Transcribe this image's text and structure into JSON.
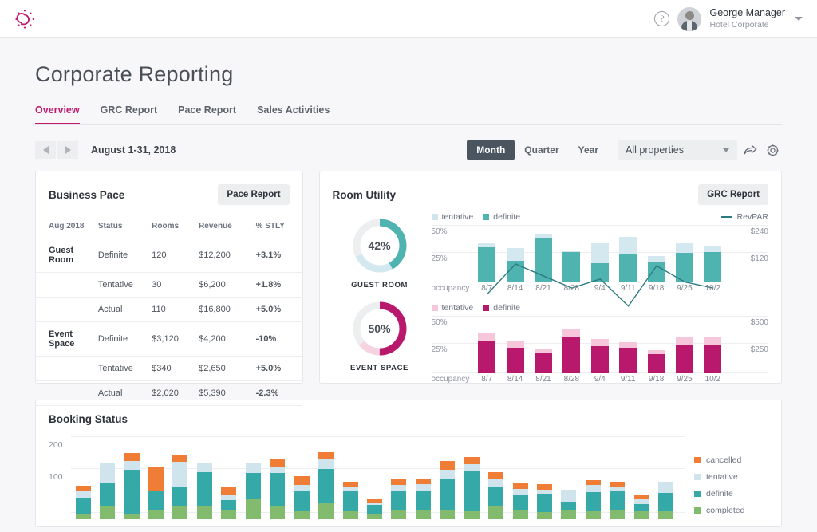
{
  "topbar": {
    "logo_icon": "sun-bulb-logo-icon",
    "help_icon": "help-circle-icon",
    "help_label": "?",
    "avatar_icon": "user-avatar",
    "user_name": "George Manager",
    "user_org": "Hotel Corporate",
    "caret_icon": "chevron-down-icon"
  },
  "page": {
    "title": "Corporate Reporting",
    "tabs": [
      {
        "label": "Overview",
        "active": true
      },
      {
        "label": "GRC Report",
        "active": false
      },
      {
        "label": "Pace Report",
        "active": false
      },
      {
        "label": "Sales Activities",
        "active": false
      }
    ]
  },
  "toolbar": {
    "prev_icon": "chevron-left-icon",
    "next_icon": "chevron-right-icon",
    "date_range": "August 1-31, 2018",
    "periods": [
      {
        "label": "Month",
        "active": true
      },
      {
        "label": "Quarter",
        "active": false
      },
      {
        "label": "Year",
        "active": false
      }
    ],
    "property_filter": "All properties",
    "share_icon": "share-arrow-icon",
    "settings_icon": "gear-icon"
  },
  "business_pace": {
    "title": "Business Pace",
    "action_label": "Pace Report",
    "columns": [
      "Aug 2018",
      "Status",
      "Rooms",
      "Revenue",
      "% STLY"
    ],
    "rows": [
      {
        "group": "Guest Room",
        "status": "Definite",
        "rooms": "120",
        "revenue": "$12,200",
        "stly": "+3.1%",
        "trend": "pos",
        "separator": false
      },
      {
        "group": "",
        "status": "Tentative",
        "rooms": "30",
        "revenue": "$6,200",
        "stly": "+1.8%",
        "trend": "pos",
        "separator": false
      },
      {
        "group": "",
        "status": "Actual",
        "rooms": "110",
        "revenue": "$16,800",
        "stly": "+5.0%",
        "trend": "pos",
        "separator": false
      },
      {
        "group": "Event Space",
        "status": "Definite",
        "rooms": "$3,120",
        "revenue": "$4,200",
        "stly": "-10%",
        "trend": "neg",
        "separator": true
      },
      {
        "group": "",
        "status": "Tentative",
        "rooms": "$340",
        "revenue": "$2,650",
        "stly": "+5.0%",
        "trend": "pos",
        "separator": false
      },
      {
        "group": "",
        "status": "Actual",
        "rooms": "$2,020",
        "revenue": "$5,390",
        "stly": "-2.3%",
        "trend": "neg",
        "separator": false
      }
    ]
  },
  "room_utility": {
    "title": "Room Utility",
    "action_label": "GRC Report",
    "donuts": [
      {
        "value": "42%",
        "label": "GUEST ROOM",
        "pct": 42,
        "secondary_pct": 26,
        "color": "#4fb3b0",
        "secondary_color": "#d4e9ef",
        "track": "#eceef0"
      },
      {
        "value": "50%",
        "label": "EVENT SPACE",
        "pct": 50,
        "secondary_pct": 14,
        "color": "#b8196c",
        "secondary_color": "#f6d3e1",
        "track": "#eceef0"
      }
    ]
  },
  "chart_data": [
    {
      "type": "bar",
      "name": "guest-room-occupancy",
      "stacked": true,
      "title": "",
      "xlabel": "occupancy",
      "ylabel": "",
      "categories": [
        "8/7",
        "8/14",
        "8/21",
        "8/28",
        "9/4",
        "9/11",
        "9/18",
        "9/25",
        "10/2"
      ],
      "yticks": [
        "25%",
        "50%"
      ],
      "ylim": [
        0,
        62
      ],
      "y2ticks": [
        "$120",
        "$240"
      ],
      "y2lim": [
        0,
        300
      ],
      "series": [
        {
          "name": "definite",
          "color": "#4fb3b0",
          "values": [
            38,
            24,
            48,
            33,
            21,
            31,
            22,
            32,
            33
          ]
        },
        {
          "name": "tentative",
          "color": "#d4e9ef",
          "values": [
            5,
            14,
            5,
            1,
            22,
            19,
            7,
            11,
            7
          ]
        }
      ],
      "line": {
        "name": "RevPAR",
        "color": "#2b7a82",
        "values": [
          185,
          235,
          215,
          195,
          210,
          165,
          232,
          205,
          195
        ]
      },
      "legend": [
        "tentative",
        "definite",
        "RevPAR"
      ],
      "legend_position": "top"
    },
    {
      "type": "bar",
      "name": "event-space-occupancy",
      "stacked": true,
      "title": "",
      "xlabel": "occupancy",
      "ylabel": "",
      "categories": [
        "8/7",
        "8/14",
        "8/21",
        "8/28",
        "9/4",
        "9/11",
        "9/18",
        "9/25",
        "10/2"
      ],
      "yticks": [
        "25%",
        "50%"
      ],
      "ylim": [
        0,
        62
      ],
      "y2ticks": [
        "$250",
        "$500"
      ],
      "y2lim": [
        0,
        620
      ],
      "series": [
        {
          "name": "definite",
          "color": "#b8196c",
          "values": [
            35,
            28,
            22,
            39,
            30,
            28,
            21,
            31,
            31
          ]
        },
        {
          "name": "tentative",
          "color": "#f6c6da",
          "values": [
            9,
            7,
            4,
            10,
            8,
            6,
            4,
            9,
            9
          ]
        }
      ],
      "legend": [
        "tentative",
        "definite"
      ],
      "legend_position": "top"
    },
    {
      "type": "bar",
      "name": "booking-status",
      "stacked": true,
      "title": "Booking Status",
      "xlabel": "",
      "ylabel": "",
      "categories": [
        "1",
        "2",
        "3",
        "4",
        "5",
        "6",
        "7",
        "8",
        "9",
        "10",
        "11",
        "12",
        "13",
        "14",
        "15",
        "16",
        "17",
        "18",
        "19",
        "20",
        "21",
        "22",
        "23",
        "24",
        "25"
      ],
      "yticks": [
        "100",
        "200"
      ],
      "ylim": [
        0,
        230
      ],
      "series": [
        {
          "name": "completed",
          "color": "#83bb6e",
          "values": [
            18,
            40,
            16,
            28,
            38,
            40,
            26,
            62,
            40,
            25,
            48,
            24,
            14,
            28,
            28,
            30,
            25,
            38,
            28,
            22,
            30,
            25,
            26,
            24,
            24
          ]
        },
        {
          "name": "definite",
          "color": "#35a8a8",
          "values": [
            48,
            68,
            134,
            60,
            58,
            104,
            32,
            78,
            100,
            60,
            105,
            60,
            30,
            58,
            58,
            90,
            120,
            62,
            48,
            55,
            24,
            58,
            60,
            22,
            56
          ]
        },
        {
          "name": "tentative",
          "color": "#cfe4ed",
          "values": [
            18,
            62,
            26,
            0,
            78,
            28,
            18,
            30,
            20,
            18,
            30,
            12,
            4,
            18,
            20,
            30,
            22,
            22,
            16,
            12,
            36,
            20,
            14,
            14,
            34
          ]
        },
        {
          "name": "cancelled",
          "color": "#ef7d35",
          "values": [
            18,
            0,
            24,
            72,
            22,
            0,
            20,
            0,
            22,
            28,
            20,
            18,
            14,
            18,
            18,
            26,
            22,
            20,
            18,
            18,
            0,
            16,
            14,
            14,
            0
          ]
        }
      ],
      "legend": [
        "cancelled",
        "tentative",
        "definite",
        "completed"
      ],
      "legend_position": "right"
    }
  ],
  "booking_status": {
    "title": "Booking Status",
    "legend": [
      {
        "label": "cancelled",
        "color": "#ef7d35"
      },
      {
        "label": "tentative",
        "color": "#cfe4ed"
      },
      {
        "label": "definite",
        "color": "#35a8a8"
      },
      {
        "label": "completed",
        "color": "#83bb6e"
      }
    ]
  },
  "colors": {
    "brand": "#c0186b",
    "teal": "#4fb3b0",
    "teal_light": "#d4e9ef",
    "magenta": "#b8196c",
    "magenta_light": "#f6c6da",
    "positive": "#3d9a3d",
    "negative": "#e0453b",
    "dark": "#4a5560"
  }
}
